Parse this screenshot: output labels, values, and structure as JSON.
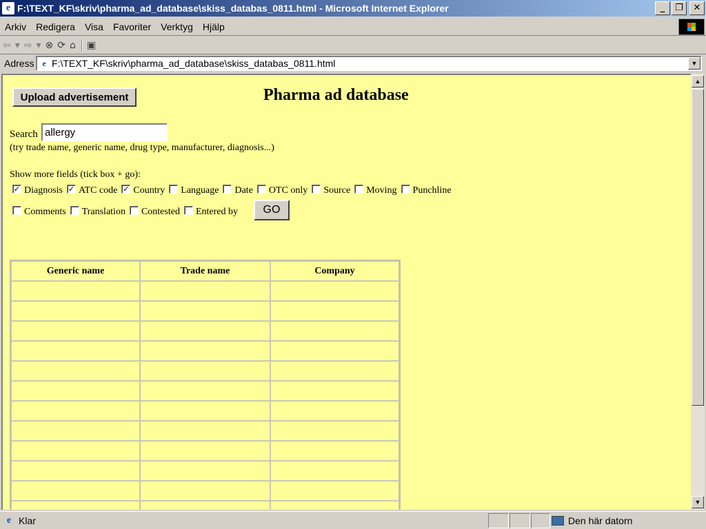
{
  "window": {
    "title": "F:\\TEXT_KF\\skriv\\pharma_ad_database\\skiss_databas_0811.html - Microsoft Internet Explorer"
  },
  "menu": [
    "Arkiv",
    "Redigera",
    "Visa",
    "Favoriter",
    "Verktyg",
    "Hjälp"
  ],
  "address": {
    "label": "Adress",
    "url": "F:\\TEXT_KF\\skriv\\pharma_ad_database\\skiss_databas_0811.html"
  },
  "page": {
    "upload_label": "Upload advertisement",
    "title": "Pharma ad database",
    "search_label": "Search",
    "search_value": "allergy",
    "search_hint": "(try trade name, generic name, drug type, manufacturer, diagnosis...)",
    "fields_label": "Show more fields (tick box + go):",
    "fields_row1": [
      {
        "label": "Diagnosis",
        "checked": true
      },
      {
        "label": "ATC code",
        "checked": true
      },
      {
        "label": "Country",
        "checked": true
      },
      {
        "label": "Language",
        "checked": false
      },
      {
        "label": "Date",
        "checked": false
      },
      {
        "label": "OTC only",
        "checked": false
      },
      {
        "label": "Source",
        "checked": false
      },
      {
        "label": "Moving",
        "checked": false
      },
      {
        "label": "Punchline",
        "checked": false
      }
    ],
    "fields_row2": [
      {
        "label": "Comments",
        "checked": false
      },
      {
        "label": "Translation",
        "checked": false
      },
      {
        "label": "Contested",
        "checked": false
      },
      {
        "label": "Entered by",
        "checked": false
      }
    ],
    "go_label": "GO",
    "table": {
      "headers": [
        "Generic name",
        "Trade name",
        "Company"
      ],
      "empty_rows": 12
    }
  },
  "status": {
    "text": "Klar",
    "zone": "Den här datorn"
  },
  "colors": {
    "page_background": "#ffff99",
    "titlebar_start": "#0a246a",
    "titlebar_end": "#a6caf0"
  }
}
